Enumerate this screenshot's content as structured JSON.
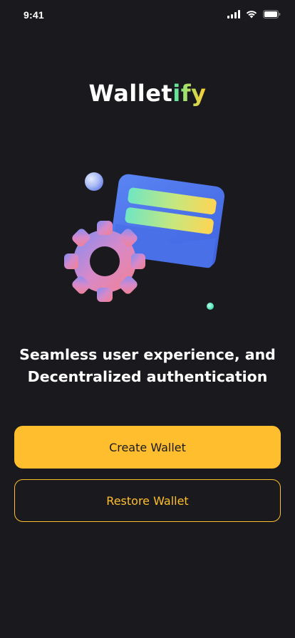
{
  "status_bar": {
    "time": "9:41",
    "icons": [
      "cellular-signal-icon",
      "wifi-icon",
      "battery-icon"
    ]
  },
  "logo": {
    "text_white": "Wallet",
    "text_gradient": "ify"
  },
  "illustration": {
    "elements": [
      "wallet-icon",
      "gear-icon",
      "orb-blue",
      "orb-teal"
    ]
  },
  "headline": {
    "line1": "Seamless user experience, and",
    "line2": "Decentralized authentication"
  },
  "actions": {
    "create_label": "Create Wallet",
    "restore_label": "Restore Wallet"
  },
  "colors": {
    "background": "#1a1a1e",
    "accent": "#ffbe2e",
    "text": "#ffffff"
  }
}
